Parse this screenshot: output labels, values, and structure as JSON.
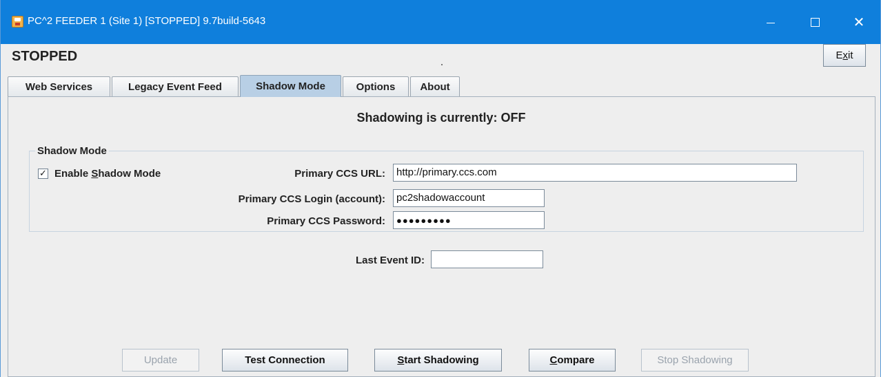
{
  "window": {
    "title": "PC^2 FEEDER 1 (Site 1) [STOPPED] 9.7build-5643",
    "controls": {
      "minimize_icon": "minimize-icon",
      "maximize_icon": "maximize-icon",
      "close_icon": "close-icon"
    },
    "accent_color": "#0f7fdc"
  },
  "header": {
    "status": "STOPPED",
    "exit_pre": "E",
    "exit_mnemonic": "x",
    "exit_post": "it"
  },
  "tabs": [
    {
      "label": "Web Services",
      "active": false
    },
    {
      "label": "Legacy Event Feed",
      "active": false
    },
    {
      "label": "Shadow Mode",
      "active": true
    },
    {
      "label": "Options",
      "active": false
    },
    {
      "label": "About",
      "active": false
    }
  ],
  "shadow": {
    "status_text": "Shadowing is currently:  OFF",
    "group_title": "Shadow Mode",
    "enable": {
      "checked": true,
      "label_pre": "Enable ",
      "label_mnemonic": "S",
      "label_post": "hadow Mode"
    },
    "primary_url": {
      "label": "Primary CCS URL:",
      "value": "http://primary.ccs.com"
    },
    "login": {
      "label": "Primary CCS Login (account):",
      "value": "pc2shadowaccount"
    },
    "password": {
      "label": "Primary CCS Password:",
      "value": "●●●●●●●●●"
    },
    "last_event": {
      "label": "Last Event ID:",
      "value": ""
    }
  },
  "buttons": {
    "update": {
      "label": "Update",
      "enabled": false
    },
    "test_connection": {
      "label": "Test Connection",
      "enabled": true
    },
    "start_shadowing": {
      "mnemonic": "S",
      "post": "tart Shadowing",
      "enabled": true
    },
    "compare": {
      "mnemonic": "C",
      "post": "ompare",
      "enabled": true
    },
    "stop_shadowing": {
      "label": "Stop Shadowing",
      "enabled": false
    }
  }
}
